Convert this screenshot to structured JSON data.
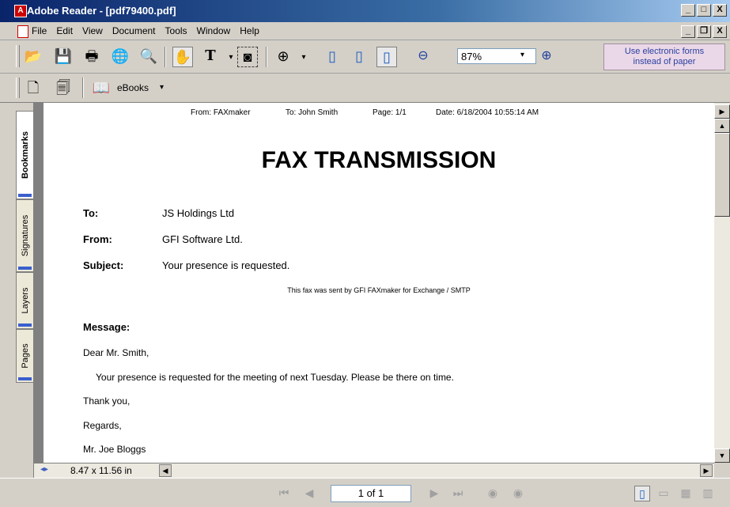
{
  "window": {
    "title": "Adobe Reader - [pdf79400.pdf]",
    "app_icon": "A",
    "controls": [
      "_",
      "□",
      "X"
    ],
    "doc_controls": [
      "_",
      "❐",
      "X"
    ]
  },
  "menu": [
    "File",
    "Edit",
    "View",
    "Document",
    "Tools",
    "Window",
    "Help"
  ],
  "toolbar": {
    "zoom_value": "87%",
    "eforms_line1": "Use electronic forms",
    "eforms_line2": "instead of paper",
    "ebooks_label": "eBooks",
    "icons": [
      "open-icon",
      "save-icon",
      "print-icon",
      "email-icon",
      "search-icon",
      "hand-tool-icon",
      "select-text-icon",
      "snapshot-icon",
      "zoom-in-tool-icon",
      "actual-size-icon",
      "fit-page-icon",
      "fit-width-icon",
      "zoom-out-icon",
      "zoom-in-icon"
    ]
  },
  "side_tabs": [
    "Bookmarks",
    "Signatures",
    "Layers",
    "Pages"
  ],
  "document": {
    "header_from": "From: FAXmaker",
    "header_to": "To: John Smith",
    "header_page": "Page: 1/1",
    "header_date": "Date: 6/18/2004 10:55:14 AM",
    "title": "FAX TRANSMISSION",
    "fields": [
      {
        "label": "To:",
        "value": "JS Holdings Ltd"
      },
      {
        "label": "From:",
        "value": "GFI Software Ltd."
      },
      {
        "label": "Subject:",
        "value": "Your presence is requested."
      }
    ],
    "note": "This fax was sent by GFI FAXmaker for Exchange / SMTP",
    "message_label": "Message:",
    "greeting": "Dear Mr. Smith,",
    "body": "Your presence is requested for the meeting of next Tuesday. Please be there on time.",
    "thanks": "Thank you,",
    "regards": "Regards,",
    "signature": "Mr. Joe Bloggs"
  },
  "page_size": "8.47 x 11.56 in",
  "status": {
    "page_indicator": "1 of 1"
  }
}
